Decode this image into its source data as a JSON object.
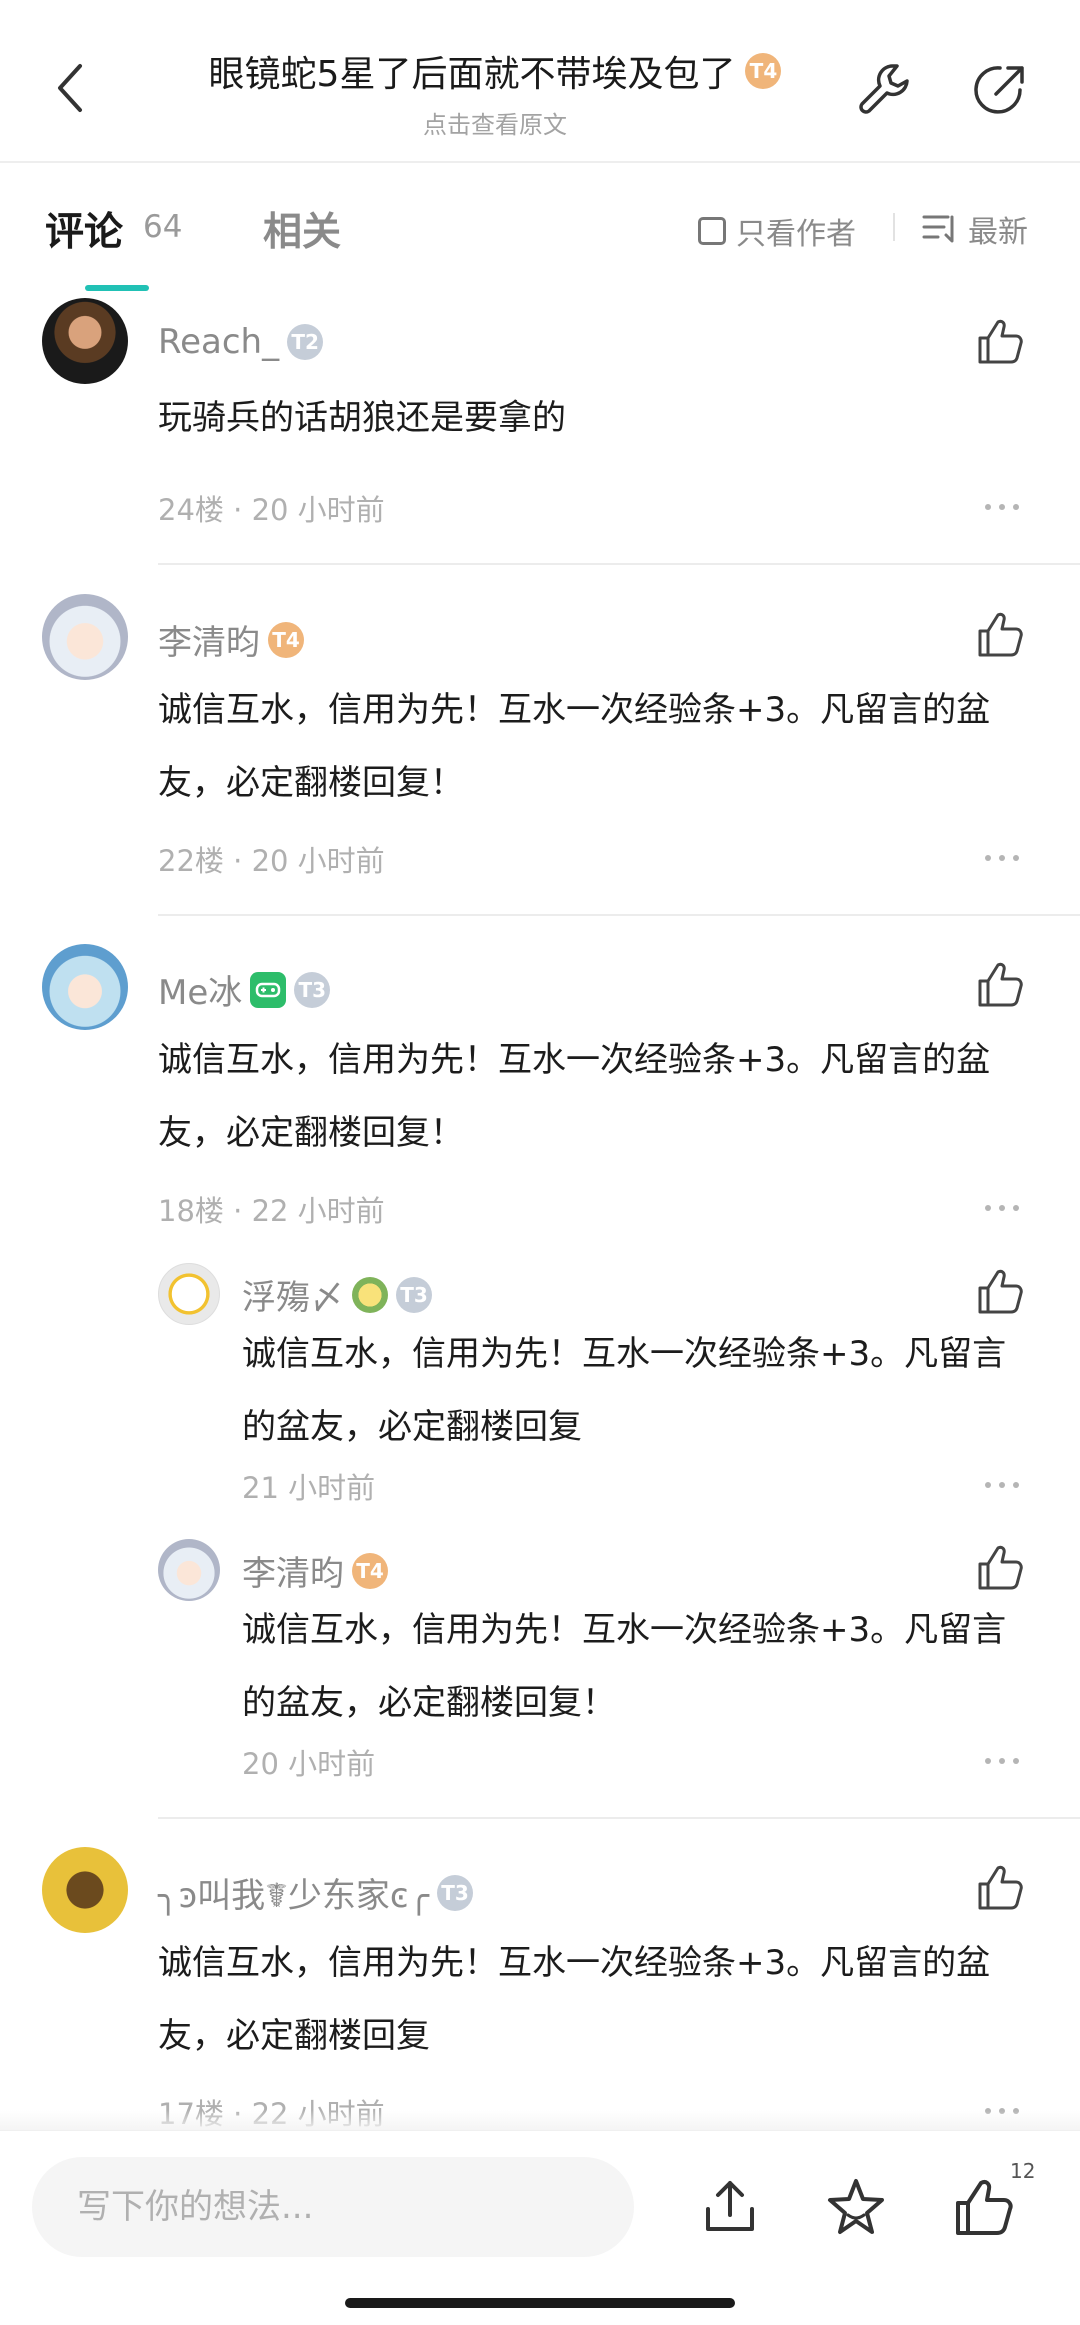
{
  "header": {
    "title": "眼镜蛇5星了后面就不带埃及包了",
    "title_badge": "T4",
    "subtitle": "点击查看原文"
  },
  "tabs": {
    "comments_label": "评论",
    "comments_count": "64",
    "related_label": "相关",
    "author_only_label": "只看作者",
    "sort_label": "最新"
  },
  "comments": [
    {
      "user": "Reach_",
      "badge": "T2",
      "text": "玩骑兵的话胡狼还是要拿的",
      "floor": "24楼",
      "time": "20 小时前"
    },
    {
      "user": "李清昀",
      "badge": "T4",
      "text": "诚信互水，信用为先！互水一次经验条+3。凡留言的盆友，必定翻楼回复！",
      "floor": "22楼",
      "time": "20 小时前"
    },
    {
      "user": "Me冰",
      "badge": "T3",
      "text": "诚信互水，信用为先！互水一次经验条+3。凡留言的盆友，必定翻楼回复！",
      "floor": "18楼",
      "time": "22 小时前",
      "replies": [
        {
          "user": "浮殤〆",
          "badge": "T3",
          "text": "诚信互水，信用为先！互水一次经验条+3。凡留言的盆友，必定翻楼回复",
          "time": "21 小时前"
        },
        {
          "user": "李清昀",
          "badge": "T4",
          "text": "诚信互水，信用为先！互水一次经验条+3。凡留言的盆友，必定翻楼回复！",
          "time": "20 小时前"
        }
      ]
    },
    {
      "user": "╮ͽ叫我☤少东家ͼ╭",
      "badge": "T3",
      "text": "诚信互水，信用为先！互水一次经验条+3。凡留言的盆友，必定翻楼回复",
      "floor": "17楼",
      "time": "22 小时前"
    }
  ],
  "bottom": {
    "placeholder": "写下你的想法...",
    "like_count": "12"
  },
  "colors": {
    "accent": "#21c1b5",
    "badge_gold": "#f0b57a",
    "badge_silver": "#c5cdd8"
  }
}
